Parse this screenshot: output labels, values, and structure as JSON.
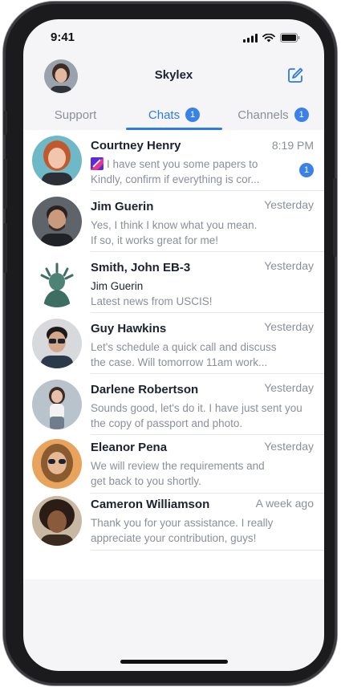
{
  "status_bar": {
    "time": "9:41"
  },
  "header": {
    "title": "Skylex"
  },
  "tabs": [
    {
      "label": "Support"
    },
    {
      "label": "Chats",
      "badge": "1",
      "active": true
    },
    {
      "label": "Channels",
      "badge": "1"
    }
  ],
  "chats": [
    {
      "name": "Courtney Henry",
      "time": "8:19 PM",
      "line1": "I have sent you some papers to",
      "line2": "Kindly, confirm if everything is cor...",
      "unread": "1",
      "has_attachment": true
    },
    {
      "name": "Jim Guerin",
      "time": "Yesterday",
      "line1": "Yes, I think I know what you mean.",
      "line2": "If so, it works great for me!"
    },
    {
      "name": "Smith, John EB-3",
      "time": "Yesterday",
      "sender": "Jim Guerin",
      "line2": "Latest news from USCIS!"
    },
    {
      "name": "Guy Hawkins",
      "time": "Yesterday",
      "line1": "Let's schedule a quick call and discuss",
      "line2": "the case. Will tomorrow 11am work..."
    },
    {
      "name": "Darlene Robertson",
      "time": "Yesterday",
      "line1": "Sounds good, let's do it. I have just sent you",
      "line2": "the copy of passport and photo."
    },
    {
      "name": "Eleanor Pena",
      "time": "Yesterday",
      "line1": "We will review the requirements and",
      "line2": "get back to you shortly."
    },
    {
      "name": "Cameron Williamson",
      "time": "A week ago",
      "line1": "Thank you for your assistance. I really",
      "line2": "appreciate your contribution, guys!"
    }
  ],
  "colors": {
    "accent": "#2d7be5",
    "badge": "#3b82e8",
    "muted": "#8a8f98",
    "text": "#1c2230"
  },
  "icons": [
    "cellular-signal-icon",
    "wifi-icon",
    "battery-icon",
    "compose-icon",
    "attachment-thumbnail-icon"
  ]
}
